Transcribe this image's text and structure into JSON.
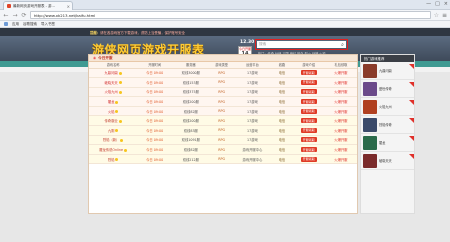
{
  "browser": {
    "tab_title": "最新网页游戏开服表 - 游...",
    "tab_close": "×",
    "window_controls": [
      "—",
      "□",
      "×"
    ],
    "back": "←",
    "forward": "→",
    "reload": "⟳",
    "url": "http://www.xk213.net/kaifu.html",
    "bookmarks": [
      "应用",
      "谷歌搜索",
      "导入书签"
    ]
  },
  "page": {
    "notice": "提醒：",
    "notice_highlight": "请在各游戏官方下载游戏，谨防上当受骗，保护账号安全",
    "logo": "游侠网页游戏开服表",
    "badge_number": "12.30",
    "date_label": "今日开服",
    "date_day": "14",
    "search": {
      "placeholder": "搜索",
      "button": "⌕"
    },
    "hotwords": "热门：传奇 仙侠 三国 魔幻 热血 烈火 战神 火影",
    "nav": {
      "items": [
        "开服表",
        "今日开服",
        "明日开服",
        "已开新服",
        "开服测试",
        "游戏排行"
      ],
      "dropdown": "开服查询 ▾",
      "publish": "■ 我要发布"
    },
    "subnav": [
      "传奇",
      "仙侠",
      "九州",
      "三国",
      "魔幻",
      "武侠",
      "热血",
      "角色",
      "战争",
      "策略",
      "动作",
      "休闲",
      "卡牌",
      "其他"
    ]
  },
  "table": {
    "section_title": "今日开服",
    "section_icon": "◉",
    "headers": [
      "游戏名称",
      "开服时间",
      "服务器",
      "游戏类型",
      "运营平台",
      "线路",
      "游戏介绍",
      "礼包领取"
    ],
    "hot_rows": [
      {
        "name": "九鼎问鼎",
        "time": "今日 09:00",
        "server": "双线3000服",
        "type": "RPG",
        "op": "17游戏",
        "line": "电信",
        "intro": "开服领取",
        "gift": "火爆开服"
      },
      {
        "name": "破晓天天",
        "time": "今日 09:00",
        "server": "双线153服",
        "type": "RPG",
        "op": "17游戏",
        "line": "电信",
        "intro": "开服领取",
        "gift": "火爆开服"
      },
      {
        "name": "火焰九州",
        "time": "今日 09:00",
        "server": "双线375服",
        "type": "RPG",
        "op": "17游戏",
        "line": "电信",
        "intro": "开服领取",
        "gift": "火爆开服"
      },
      {
        "name": "屠龙",
        "time": "今日 09:00",
        "server": "双线200服",
        "type": "RPG",
        "op": "17游戏",
        "line": "电信",
        "intro": "开服领取",
        "gift": "火爆开服"
      },
      {
        "name": "火焰",
        "time": "今日 09:00",
        "server": "双线82服",
        "type": "RPG",
        "op": "17游戏",
        "line": "电信",
        "intro": "开服领取",
        "gift": "火爆开服"
      }
    ],
    "std_rows": [
      {
        "name": "传奇霸业",
        "time": "今日 09:00",
        "server": "双线200服",
        "type": "RPG",
        "op": "17游戏",
        "line": "电信",
        "intro": "开服领取",
        "gift": "火爆开服"
      },
      {
        "name": "九阴",
        "time": "今日 09:00",
        "server": "双线83服",
        "type": "RPG",
        "op": "17游戏",
        "line": "电信",
        "intro": "开服领取",
        "gift": "火爆开服"
      },
      {
        "name": "烈焰（新）",
        "time": "今日 09:00",
        "server": "双线1091服",
        "type": "RPG",
        "op": "17游戏",
        "line": "电信",
        "intro": "开服领取",
        "gift": "火爆开服"
      },
      {
        "name": "屠龙传说Online",
        "time": "今日 09:00",
        "server": "双线82服",
        "type": "RPG",
        "op": "游戏开服中心",
        "line": "电信",
        "intro": "开服领取",
        "gift": "火爆开服"
      },
      {
        "name": "烈焰",
        "time": "今日 09:00",
        "server": "双线212服",
        "type": "RPG",
        "op": "游戏开服中心",
        "line": "电信",
        "intro": "开服领取",
        "gift": "火爆开服"
      }
    ]
  },
  "sidebar": {
    "title": "热门游戏推荐",
    "items": [
      {
        "name": "九鼎问鼎",
        "color": "#8a3b2a"
      },
      {
        "name": "盛世传奇",
        "color": "#6b4a8a"
      },
      {
        "name": "火焰九州",
        "color": "#b04020"
      },
      {
        "name": "烈焰传奇",
        "color": "#3a4a6a"
      },
      {
        "name": "屠龙",
        "color": "#2a6a4a"
      },
      {
        "name": "破晓天天",
        "color": "#7a2a2a"
      }
    ]
  },
  "colors": {
    "accent_teal": "#3f9a92",
    "accent_red": "#e03b26",
    "logo_gold": "#ffcc33"
  }
}
